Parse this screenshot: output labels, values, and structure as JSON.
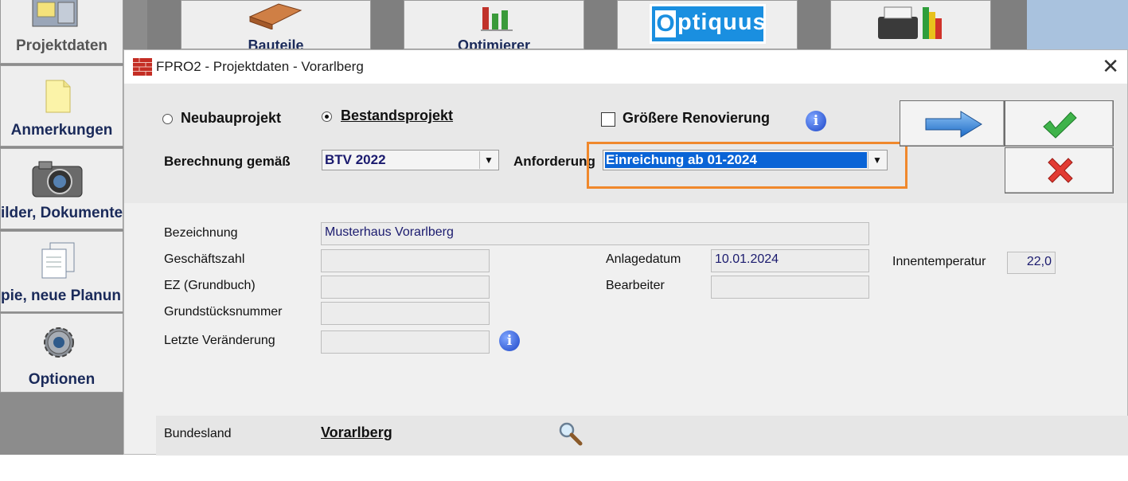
{
  "sidebar": {
    "items": [
      {
        "label": "Projektdaten",
        "icon": "filing-cabinet-icon"
      },
      {
        "label": "Anmerkungen",
        "icon": "sticky-note-icon"
      },
      {
        "label": "ilder, Dokumente",
        "icon": "camera-icon"
      },
      {
        "label": "pie, neue Planun",
        "icon": "copy-documents-icon"
      },
      {
        "label": "Optionen",
        "icon": "gear-icon"
      }
    ]
  },
  "toolbar": {
    "bauteile_label": "Bauteile",
    "optimierer_label": "Optimierer",
    "optiquus_logo": "ptiquus",
    "optiquus_logo_o": "O"
  },
  "dialog": {
    "title": "FPRO2 - Projektdaten - Vorarlberg",
    "project_type": {
      "neubau_label": "Neubauprojekt",
      "bestand_label": "Bestandsprojekt",
      "selected": "Bestandsprojekt"
    },
    "renovation_label": "Größere Renovierung",
    "renovation_checked": false,
    "berechnung_label": "Berechnung gemäß",
    "berechnung_value": "BTV 2022",
    "anforderung_label": "Anforderung",
    "anforderung_value": "Einreichung ab 01-2024",
    "highlight_color": "#f0882c",
    "fields": {
      "bezeichnung_label": "Bezeichnung",
      "bezeichnung_value": "Musterhaus Vorarlberg",
      "geschaeftszahl_label": "Geschäftszahl",
      "geschaeftszahl_value": "",
      "ez_label": "EZ (Grundbuch)",
      "ez_value": "",
      "grundstueck_label": "Grundstücksnummer",
      "grundstueck_value": "",
      "letzte_label": "Letzte Veränderung",
      "letzte_value": "",
      "anlagedatum_label": "Anlagedatum",
      "anlagedatum_value": "10.01.2024",
      "bearbeiter_label": "Bearbeiter",
      "bearbeiter_value": "",
      "innentemp_label": "Innentemperatur",
      "innentemp_value": "22,0"
    },
    "bundesland_label": "Bundesland",
    "bundesland_value": "Vorarlberg"
  }
}
